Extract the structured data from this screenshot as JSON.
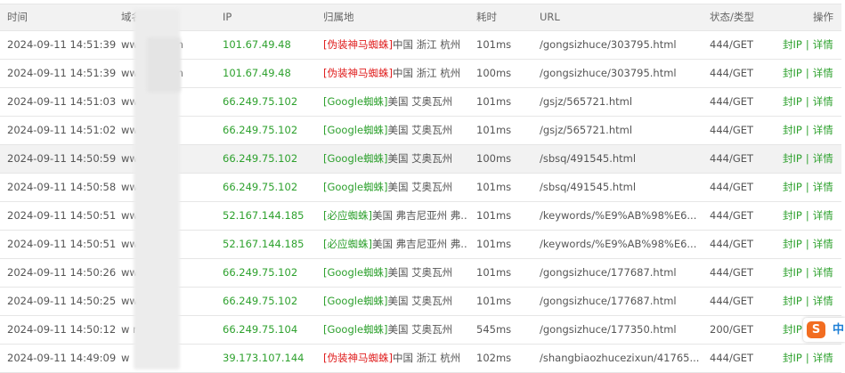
{
  "table": {
    "headers": {
      "time": "时间",
      "domain": "域名",
      "ip": "IP",
      "location": "归属地",
      "latency": "耗时",
      "url": "URL",
      "status": "状态/类型",
      "action": "操作"
    },
    "rows": [
      {
        "time": "2024-09-11 14:51:39",
        "domain": "www.         u.com",
        "ip": "101.67.49.48",
        "tag": "[伪装神马蜘蛛]",
        "location": "中国 浙江 杭州",
        "latency": "101ms",
        "url": "/gongsizhuce/303795.html",
        "status": "444/GET",
        "ban": "封IP",
        "detail": "详情"
      },
      {
        "time": "2024-09-11 14:51:39",
        "domain": "www.         u.com",
        "ip": "101.67.49.48",
        "tag": "[伪装神马蜘蛛]",
        "location": "中国 浙江 杭州",
        "latency": "100ms",
        "url": "/gongsizhuce/303795.html",
        "status": "444/GET",
        "ban": "封IP",
        "detail": "详情"
      },
      {
        "time": "2024-09-11 14:51:03",
        "domain": "ww              u.com",
        "ip": "66.249.75.102",
        "tag": "[Google蜘蛛]",
        "location": "美国 艾奥瓦州",
        "latency": "101ms",
        "url": "/gsjz/565721.html",
        "status": "444/GET",
        "ban": "封IP",
        "detail": "详情"
      },
      {
        "time": "2024-09-11 14:51:02",
        "domain": "ww              m",
        "ip": "66.249.75.102",
        "tag": "[Google蜘蛛]",
        "location": "美国 艾奥瓦州",
        "latency": "101ms",
        "url": "/gsjz/565721.html",
        "status": "444/GET",
        "ban": "封IP",
        "detail": "详情"
      },
      {
        "time": "2024-09-11 14:50:59",
        "domain": "www              om",
        "ip": "66.249.75.102",
        "tag": "[Google蜘蛛]",
        "location": "美国 艾奥瓦州",
        "latency": "100ms",
        "url": "/sbsq/491545.html",
        "status": "444/GET",
        "ban": "封IP",
        "detail": "详情"
      },
      {
        "time": "2024-09-11 14:50:58",
        "domain": "ww               om",
        "ip": "66.249.75.102",
        "tag": "[Google蜘蛛]",
        "location": "美国 艾奥瓦州",
        "latency": "101ms",
        "url": "/sbsq/491545.html",
        "status": "444/GET",
        "ban": "封IP",
        "detail": "详情"
      },
      {
        "time": "2024-09-11 14:50:51",
        "domain": "ww               m",
        "ip": "52.167.144.185",
        "tag": "[必应蜘蛛]",
        "location": "美国 弗吉尼亚州 弗...",
        "latency": "101ms",
        "url": "/keywords/%E9%AB%98%E6...",
        "status": "444/GET",
        "ban": "封IP",
        "detail": "详情"
      },
      {
        "time": "2024-09-11 14:50:51",
        "domain": "ww               m",
        "ip": "52.167.144.185",
        "tag": "[必应蜘蛛]",
        "location": "美国 弗吉尼亚州 弗...",
        "latency": "101ms",
        "url": "/keywords/%E9%AB%98%E6...",
        "status": "444/GET",
        "ban": "封IP",
        "detail": "详情"
      },
      {
        "time": "2024-09-11 14:50:26",
        "domain": "ww               m",
        "ip": "66.249.75.102",
        "tag": "[Google蜘蛛]",
        "location": "美国 艾奥瓦州",
        "latency": "101ms",
        "url": "/gongsizhuce/177687.html",
        "status": "444/GET",
        "ban": "封IP",
        "detail": "详情"
      },
      {
        "time": "2024-09-11 14:50:25",
        "domain": "ww               m",
        "ip": "66.249.75.102",
        "tag": "[Google蜘蛛]",
        "location": "美国 艾奥瓦州",
        "latency": "101ms",
        "url": "/gongsizhuce/177687.html",
        "status": "444/GET",
        "ban": "封IP",
        "detail": "详情"
      },
      {
        "time": "2024-09-11 14:50:12",
        "domain": "w                m",
        "ip": "66.249.75.104",
        "tag": "[Google蜘蛛]",
        "location": "美国 艾奥瓦州",
        "latency": "545ms",
        "url": "/gongsizhuce/177350.html",
        "status": "200/GET",
        "ban": "封IP",
        "detail": "详情"
      },
      {
        "time": "2024-09-11 14:49:09",
        "domain": "w                ",
        "ip": "39.173.107.144",
        "tag": "[伪装神马蜘蛛]",
        "location": "中国 浙江 杭州",
        "latency": "102ms",
        "url": "/shangbiaozhucezixun/41765...",
        "status": "444/GET",
        "ban": "封IP",
        "detail": "详情"
      }
    ]
  },
  "ime": {
    "logo": "S",
    "label": "中"
  },
  "colors": {
    "green": "#2ea12e",
    "red": "#e02020",
    "header_bg": "#f2f2f2",
    "border": "#e6e6e6"
  },
  "icons": {
    "domain_help": "help-circle-icon"
  }
}
